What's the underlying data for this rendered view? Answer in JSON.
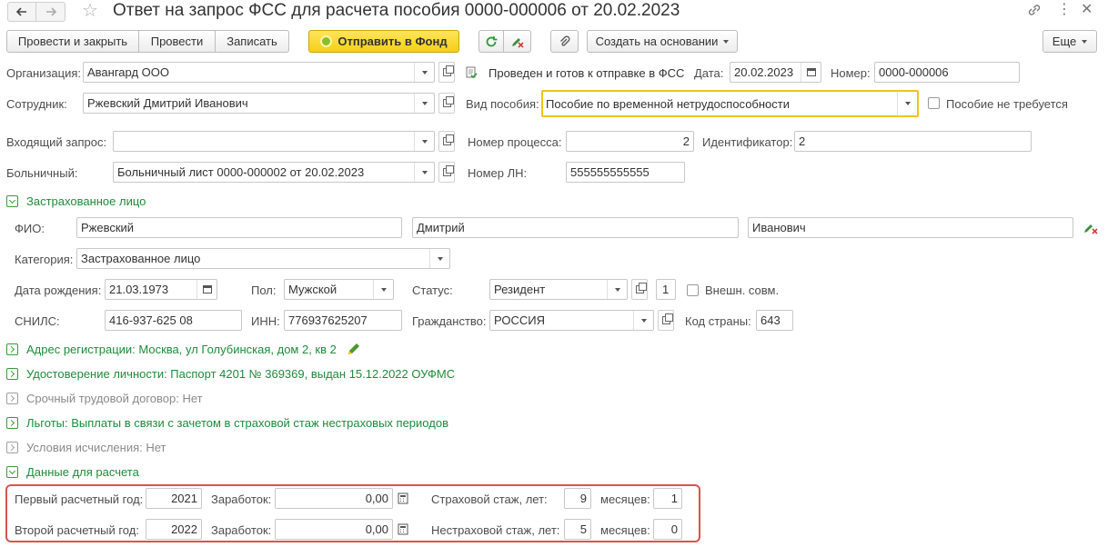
{
  "title": "Ответ на запрос ФСС для расчета пособия 0000-000006 от 20.02.2023",
  "toolbar": {
    "post_close": "Провести и закрыть",
    "post": "Провести",
    "save": "Записать",
    "send": "Отправить в Фонд",
    "create_based": "Создать на основании",
    "more": "Еще"
  },
  "header": {
    "org_label": "Организация:",
    "org_value": "Авангард ООО",
    "status_text": "Проведен и готов к отправке в ФСС",
    "date_label": "Дата:",
    "date_value": "20.02.2023",
    "number_label": "Номер:",
    "number_value": "0000-000006",
    "employee_label": "Сотрудник:",
    "employee_value": "Ржевский Дмитрий Иванович",
    "benefit_label": "Вид пособия:",
    "benefit_value": "Пособие по временной нетрудоспособности",
    "not_required_label": "Пособие не требуется",
    "request_label": "Входящий запрос:",
    "request_value": "",
    "process_label": "Номер процесса:",
    "process_value": "2",
    "identifier_label": "Идентификатор:",
    "identifier_value": "2",
    "sick_label": "Больничный:",
    "sick_value": "Больничный лист 0000-000002 от 20.02.2023",
    "ln_label": "Номер ЛН:",
    "ln_value": "555555555555"
  },
  "insured": {
    "section_title": "Застрахованное лицо",
    "fio_label": "ФИО:",
    "last_name": "Ржевский",
    "first_name": "Дмитрий",
    "middle_name": "Иванович",
    "category_label": "Категория:",
    "category_value": "Застрахованное лицо",
    "birth_label": "Дата рождения:",
    "birth_value": "21.03.1973",
    "sex_label": "Пол:",
    "sex_value": "Мужской",
    "status_label": "Статус:",
    "status_value": "Резидент",
    "status_code": "1",
    "ext_label": "Внешн. совм.",
    "snils_label": "СНИЛС:",
    "snils_value": "416-937-625 08",
    "inn_label": "ИНН:",
    "inn_value": "776937625207",
    "citizenship_label": "Гражданство:",
    "citizenship_value": "РОССИЯ",
    "country_code_label": "Код страны:",
    "country_code_value": "643"
  },
  "sections": {
    "address": "Адрес регистрации: Москва, ул Голубинская, дом 2, кв 2",
    "identity": "Удостоверение личности: Паспорт 4201 № 369369, выдан 15.12.2022 ОУФМС",
    "contract": "Срочный трудовой договор: Нет",
    "benefits": "Льготы: Выплаты в связи с зачетом в страховой стаж нестраховых периодов",
    "conditions": "Условия исчисления: Нет",
    "calc": "Данные для расчета"
  },
  "calc": {
    "year1_label": "Первый расчетный год:",
    "year1_value": "2021",
    "earn_label": "Заработок:",
    "earn1_value": "0,00",
    "ins_exp_label": "Страховой стаж, лет:",
    "ins_exp_value": "9",
    "months_label": "месяцев:",
    "ins_months_value": "1",
    "year2_label": "Второй расчетный год:",
    "year2_value": "2022",
    "earn2_value": "0,00",
    "non_ins_exp_label": "Нестраховой стаж, лет:",
    "non_ins_exp_value": "5",
    "non_ins_months_value": "0"
  },
  "colors": {
    "accent_yellow": "#f5cf16",
    "link_green": "#1f8c3b",
    "highlight_red": "#d9534f"
  }
}
